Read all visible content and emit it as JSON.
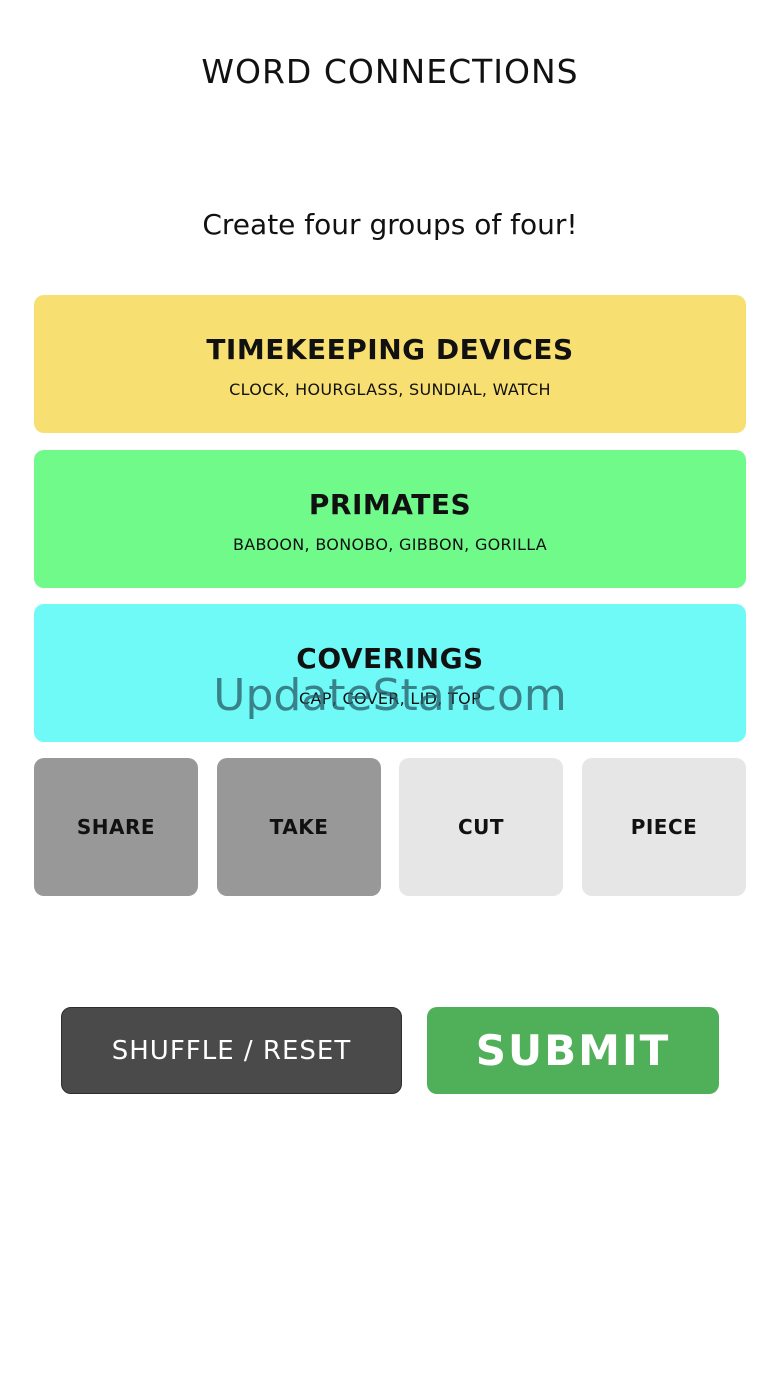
{
  "header": {
    "title": "WORD CONNECTIONS",
    "instructions": "Create four groups of four!"
  },
  "solved_groups": [
    {
      "title": "TIMEKEEPING DEVICES",
      "words": "CLOCK, HOURGLASS, SUNDIAL, WATCH",
      "color": "#f8df72"
    },
    {
      "title": "PRIMATES",
      "words": "BABOON, BONOBO, GIBBON, GORILLA",
      "color": "#6ffa8a"
    },
    {
      "title": "COVERINGS",
      "words": "CAP, COVER, LID, TOP",
      "color": "#6ffaf8"
    }
  ],
  "watermark": "UpdateStar.com",
  "tiles": [
    {
      "label": "SHARE",
      "selected": true
    },
    {
      "label": "TAKE",
      "selected": true
    },
    {
      "label": "CUT",
      "selected": false
    },
    {
      "label": "PIECE",
      "selected": false
    }
  ],
  "actions": {
    "shuffle_label": "SHUFFLE / RESET",
    "submit_label": "SUBMIT"
  },
  "colors": {
    "tile_selected": "#989898",
    "tile_unselected": "#e6e6e6",
    "shuffle_button": "#4a4a4a",
    "submit_button": "#50b05a"
  }
}
